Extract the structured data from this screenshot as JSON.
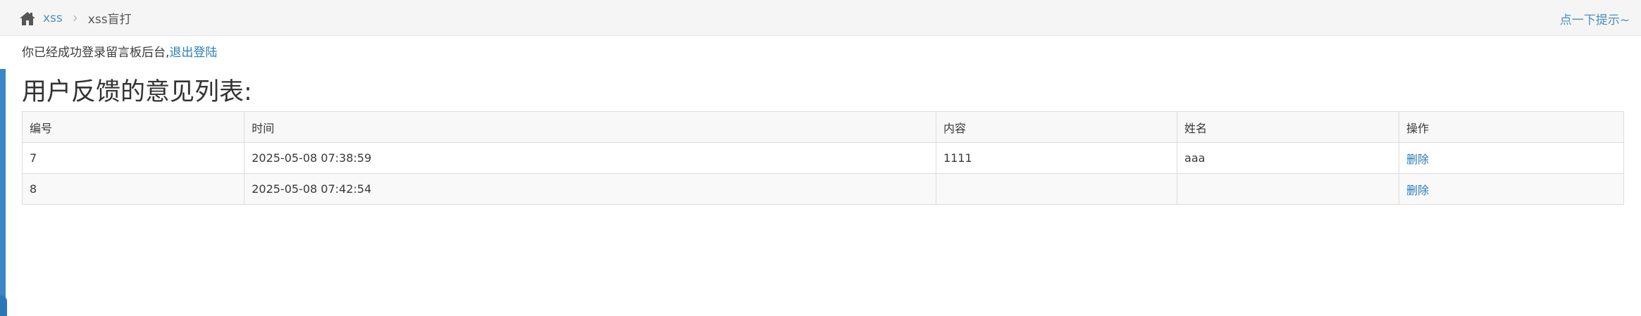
{
  "breadcrumb": {
    "home_link": "xss",
    "current": "xss盲打"
  },
  "hint_link": "点一下提示~",
  "login_message": {
    "text": "你已经成功登录留言板后台,",
    "logout_label": "退出登陆"
  },
  "page_title": "用户反馈的意见列表:",
  "table": {
    "headers": [
      "编号",
      "时间",
      "内容",
      "姓名",
      "操作"
    ],
    "rows": [
      {
        "id": "7",
        "time": "2025-05-08 07:38:59",
        "content": "1111",
        "name": "aaa",
        "action": "删除"
      },
      {
        "id": "8",
        "time": "2025-05-08 07:42:54",
        "content": "",
        "name": "",
        "action": "删除"
      }
    ]
  },
  "colors": {
    "link": "#4c8fbd",
    "accent": "#3a86c6",
    "breadcrumb_bg": "#f5f5f5"
  },
  "icons": {
    "home": "home-icon",
    "separator": "chevron-right-icon"
  }
}
